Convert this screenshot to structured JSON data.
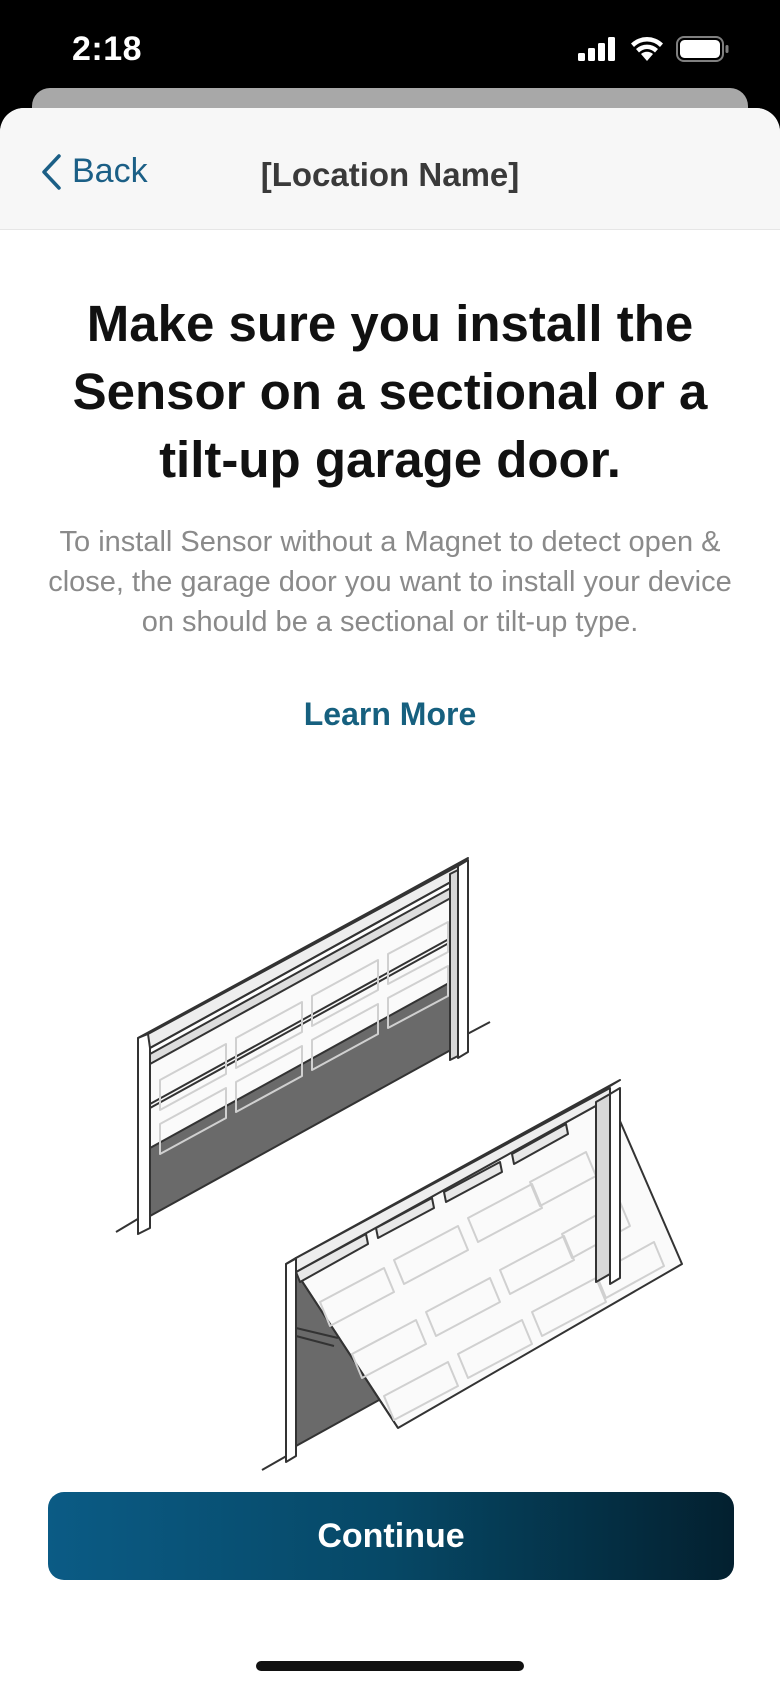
{
  "status_bar": {
    "time": "2:18",
    "signal_icon": "cellular-signal-icon",
    "wifi_icon": "wifi-icon",
    "battery_icon": "battery-icon"
  },
  "nav": {
    "back_label": "Back",
    "title": "[Location Name]"
  },
  "content": {
    "headline": "Make sure you install the Sensor on a sectional or a tilt-up garage door.",
    "body": "To install Sensor without a Magnet to detect open & close, the garage door you want to install your device on should be a sectional or tilt-up type.",
    "learn_more_label": "Learn More",
    "illustration_icon": "garage-doors-illustration"
  },
  "actions": {
    "continue_label": "Continue"
  },
  "colors": {
    "accent": "#16607f",
    "button_start": "#0b5b85",
    "button_end": "#03202f"
  }
}
